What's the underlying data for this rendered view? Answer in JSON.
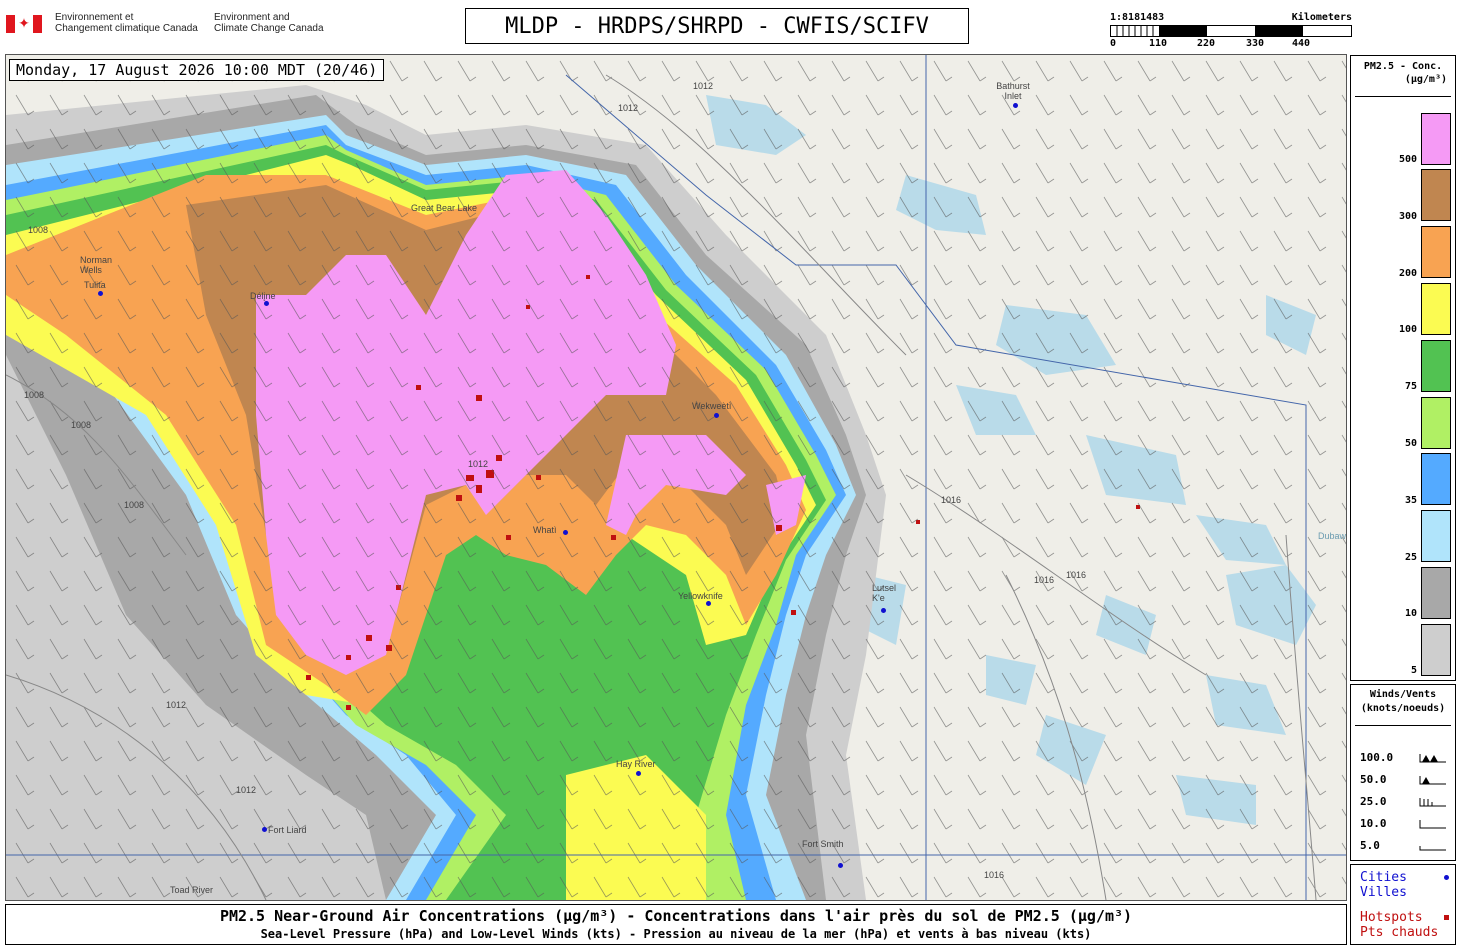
{
  "header": {
    "org_fr": "Environnement et\nChangement climatique Canada",
    "org_en": "Environment and\nClimate Change Canada",
    "title": "MLDP - HRDPS/SHRPD - CWFIS/SCIFV"
  },
  "scale": {
    "ratio": "1:8181483",
    "unit": "Kilometers",
    "ticks": [
      "0",
      "110",
      "220",
      "330",
      "440"
    ]
  },
  "map": {
    "timestamp": "Monday, 17 August 2026 10:00 MDT (20/46)",
    "cities": [
      {
        "name": "Bathurst Inlet"
      },
      {
        "name": "Norman Wells"
      },
      {
        "name": "Tulita"
      },
      {
        "name": "Délįne"
      },
      {
        "name": "Wekweètì"
      },
      {
        "name": "Whatì"
      },
      {
        "name": "Yellowknife"
      },
      {
        "name": "Lutsel K'e"
      },
      {
        "name": "Hay River"
      },
      {
        "name": "Fort Liard"
      },
      {
        "name": "Fort Smith"
      },
      {
        "name": "Toad River"
      },
      {
        "name": "Great Bear Lake"
      },
      {
        "name": "Dubawnt Lake"
      }
    ],
    "isobar_labels": [
      "1008",
      "1008",
      "1008",
      "1008",
      "1012",
      "1012",
      "1012",
      "1012",
      "1012",
      "1016",
      "1016",
      "1016",
      "1016"
    ]
  },
  "legend_conc": {
    "title": "PM2.5 - Conc.",
    "unit": "(µg/m³)",
    "levels": [
      {
        "value": "500",
        "color": "#f59af5"
      },
      {
        "value": "300",
        "color": "#c08650"
      },
      {
        "value": "200",
        "color": "#f8a352"
      },
      {
        "value": "100",
        "color": "#fbfb52"
      },
      {
        "value": "75",
        "color": "#52c252"
      },
      {
        "value": "50",
        "color": "#b0f064"
      },
      {
        "value": "35",
        "color": "#54aaff"
      },
      {
        "value": "25",
        "color": "#b0e4fb"
      },
      {
        "value": "10",
        "color": "#a8a8a8"
      },
      {
        "value": "5",
        "color": "#cecece"
      }
    ]
  },
  "legend_wind": {
    "title": "Winds/Vents\n(knots/noeuds)",
    "rows": [
      "100.0",
      "50.0",
      "25.0",
      "10.0",
      "5.0"
    ]
  },
  "legend_keys": {
    "cities": "Cities\nVilles",
    "hotspots": "Hotspots\nPts chauds",
    "city_color": "#1010d0",
    "hotspot_color": "#c01010"
  },
  "caption": {
    "line1": "PM2.5 Near-Ground Air Concentrations (µg/m³) - Concentrations dans l'air près du sol de PM2.5 (µg/m³)",
    "line2": "Sea-Level Pressure (hPa) and Low-Level Winds (kts) - Pression au niveau de la mer (hPa) et vents à bas niveau (kts)"
  }
}
